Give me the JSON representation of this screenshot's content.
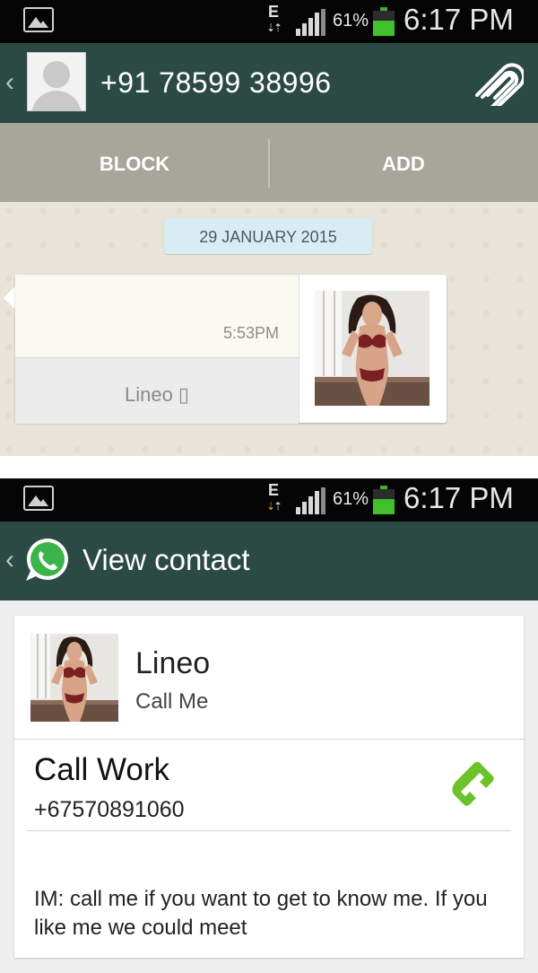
{
  "status_bar": {
    "network_type": "E",
    "battery_percent": "61%",
    "battery_level": 0.61,
    "time": "6:17 PM"
  },
  "conversation": {
    "contact_number": "+91 78599 38996",
    "actions": {
      "block": "BLOCK",
      "add": "ADD"
    },
    "date_chip": "29 JANUARY 2015",
    "message": {
      "time": "5:53PM",
      "contact_name": "Lineo ▯"
    },
    "icons": [
      "back-chevron-icon",
      "default-avatar-icon",
      "paperclip-icon"
    ]
  },
  "view_contact": {
    "title": "View contact",
    "name": "Lineo",
    "status": "Call Me",
    "call_label": "Call Work",
    "phone": "+67570891060",
    "im_text": "IM: call me if you want to get to know me. If you like me we could meet",
    "icons": [
      "back-chevron-icon",
      "whatsapp-icon",
      "phone-call-icon"
    ]
  },
  "colors": {
    "header": "#2c4a44",
    "action_bar": "#a7a69b",
    "chat_background": "#e9e4d9",
    "date_chip": "#d8ecf4",
    "battery": "#40c02a",
    "phone_icon": "#6cc22b"
  }
}
